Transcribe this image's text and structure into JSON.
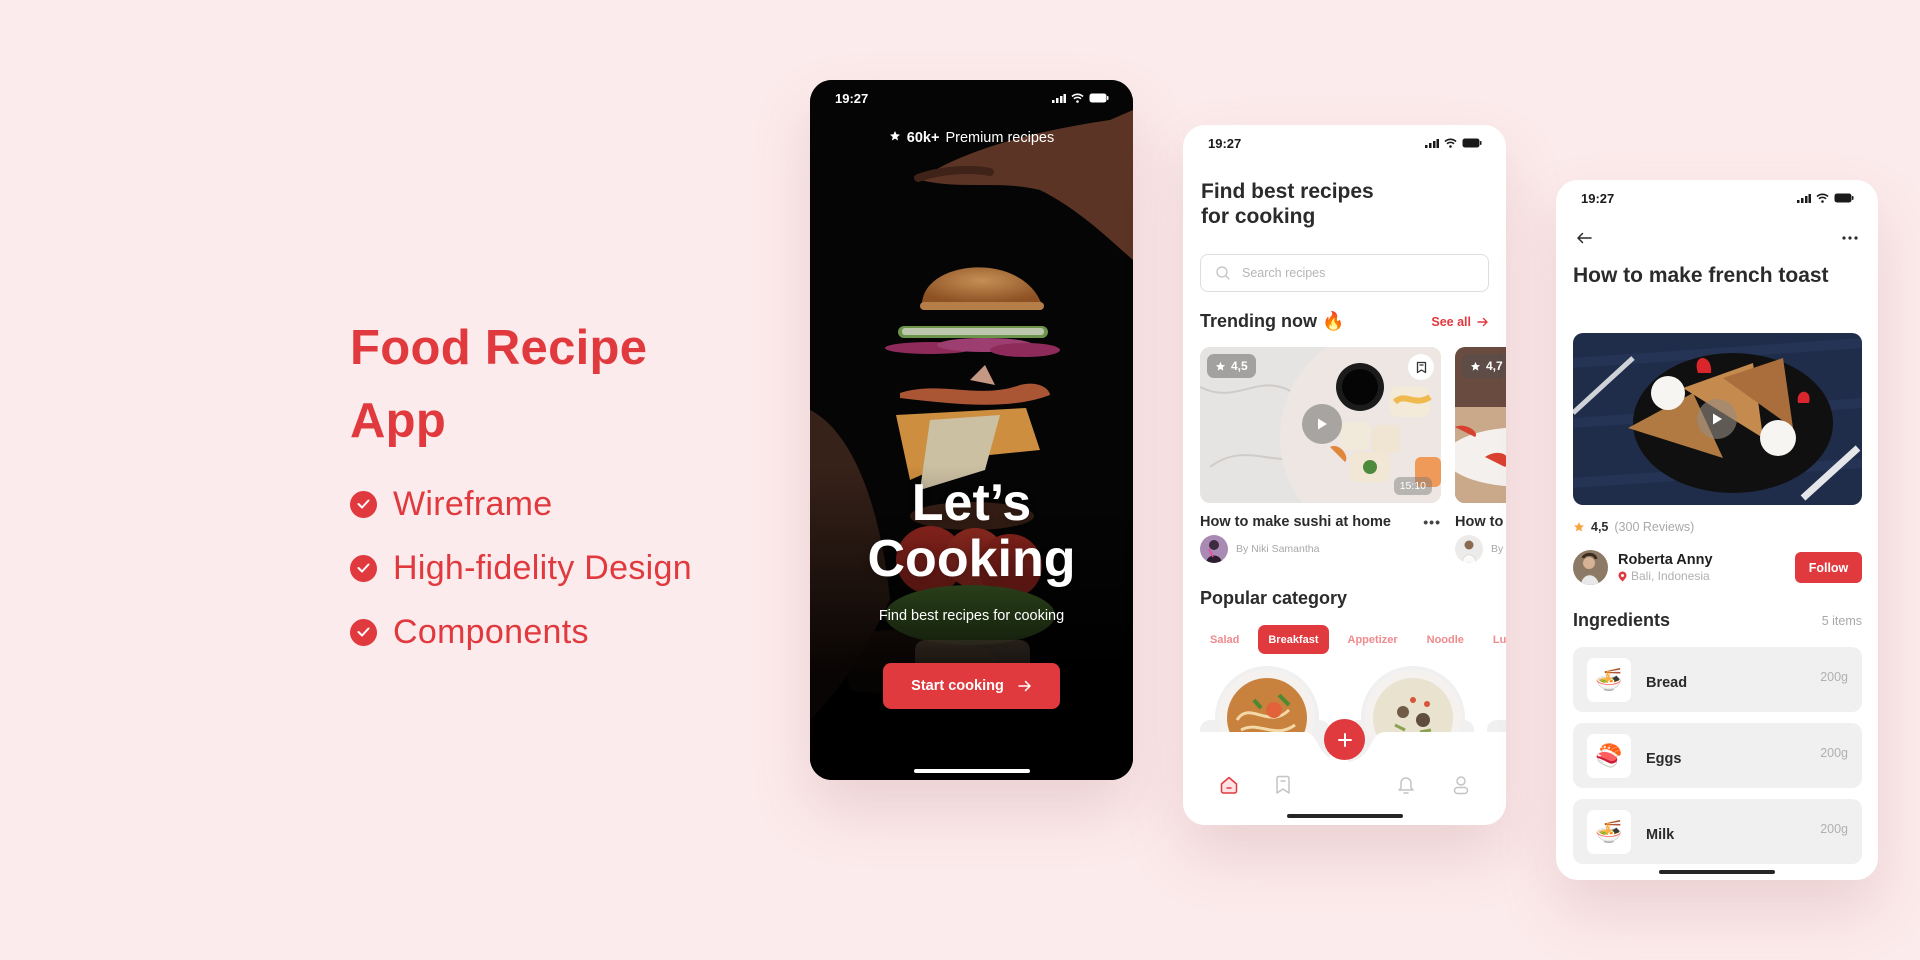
{
  "theme": {
    "accent": "#e0393e",
    "background": "#fcebec",
    "text_dark": "#2b2b2b",
    "text_muted": "#a8a8a8"
  },
  "hero": {
    "title": "Food Recipe App",
    "title_line1": "Food Recipe",
    "title_line2": "App",
    "features": [
      "Wireframe",
      "High-fidelity Design",
      "Components"
    ]
  },
  "status_bar": {
    "time": "19:27",
    "icons": [
      "signal-icon",
      "wifi-icon",
      "battery-icon"
    ]
  },
  "onboarding": {
    "badge_strong": "60k+",
    "badge_text": "Premium recipes",
    "title_line1": "Let’s",
    "title_line2": "Cooking",
    "subtitle": "Find best recipes for cooking",
    "cta_label": "Start cooking"
  },
  "home": {
    "title_line1": "Find best recipes",
    "title_line2": "for cooking",
    "search_placeholder": "Search recipes",
    "trending_title": "Trending now 🔥",
    "see_all_label": "See all",
    "trending": [
      {
        "rating": "4,5",
        "duration": "15:10",
        "title": "How to make sushi at home",
        "author": "By Niki Samantha"
      },
      {
        "rating": "4,7",
        "title": "How to",
        "author": "By"
      }
    ],
    "popular_title": "Popular category",
    "categories": [
      "Salad",
      "Breakfast",
      "Appetizer",
      "Noodle",
      "Lunch"
    ],
    "active_category": "Breakfast",
    "tabs": [
      "home-tab",
      "saved-tab",
      "add-button",
      "notifications-tab",
      "profile-tab"
    ],
    "active_tab": "home-tab"
  },
  "detail": {
    "title": "How to make french toast",
    "rating": "4,5",
    "reviews": "(300 Reviews)",
    "author_name": "Roberta Anny",
    "author_location": "Bali, Indonesia",
    "follow_label": "Follow",
    "ingredients_title": "Ingredients",
    "ingredients_count": "5 items",
    "ingredients": [
      {
        "name": "Bread",
        "qty": "200g",
        "emoji": "🍜"
      },
      {
        "name": "Eggs",
        "qty": "200g",
        "emoji": "🍣"
      },
      {
        "name": "Milk",
        "qty": "200g",
        "emoji": "🍜"
      }
    ]
  }
}
